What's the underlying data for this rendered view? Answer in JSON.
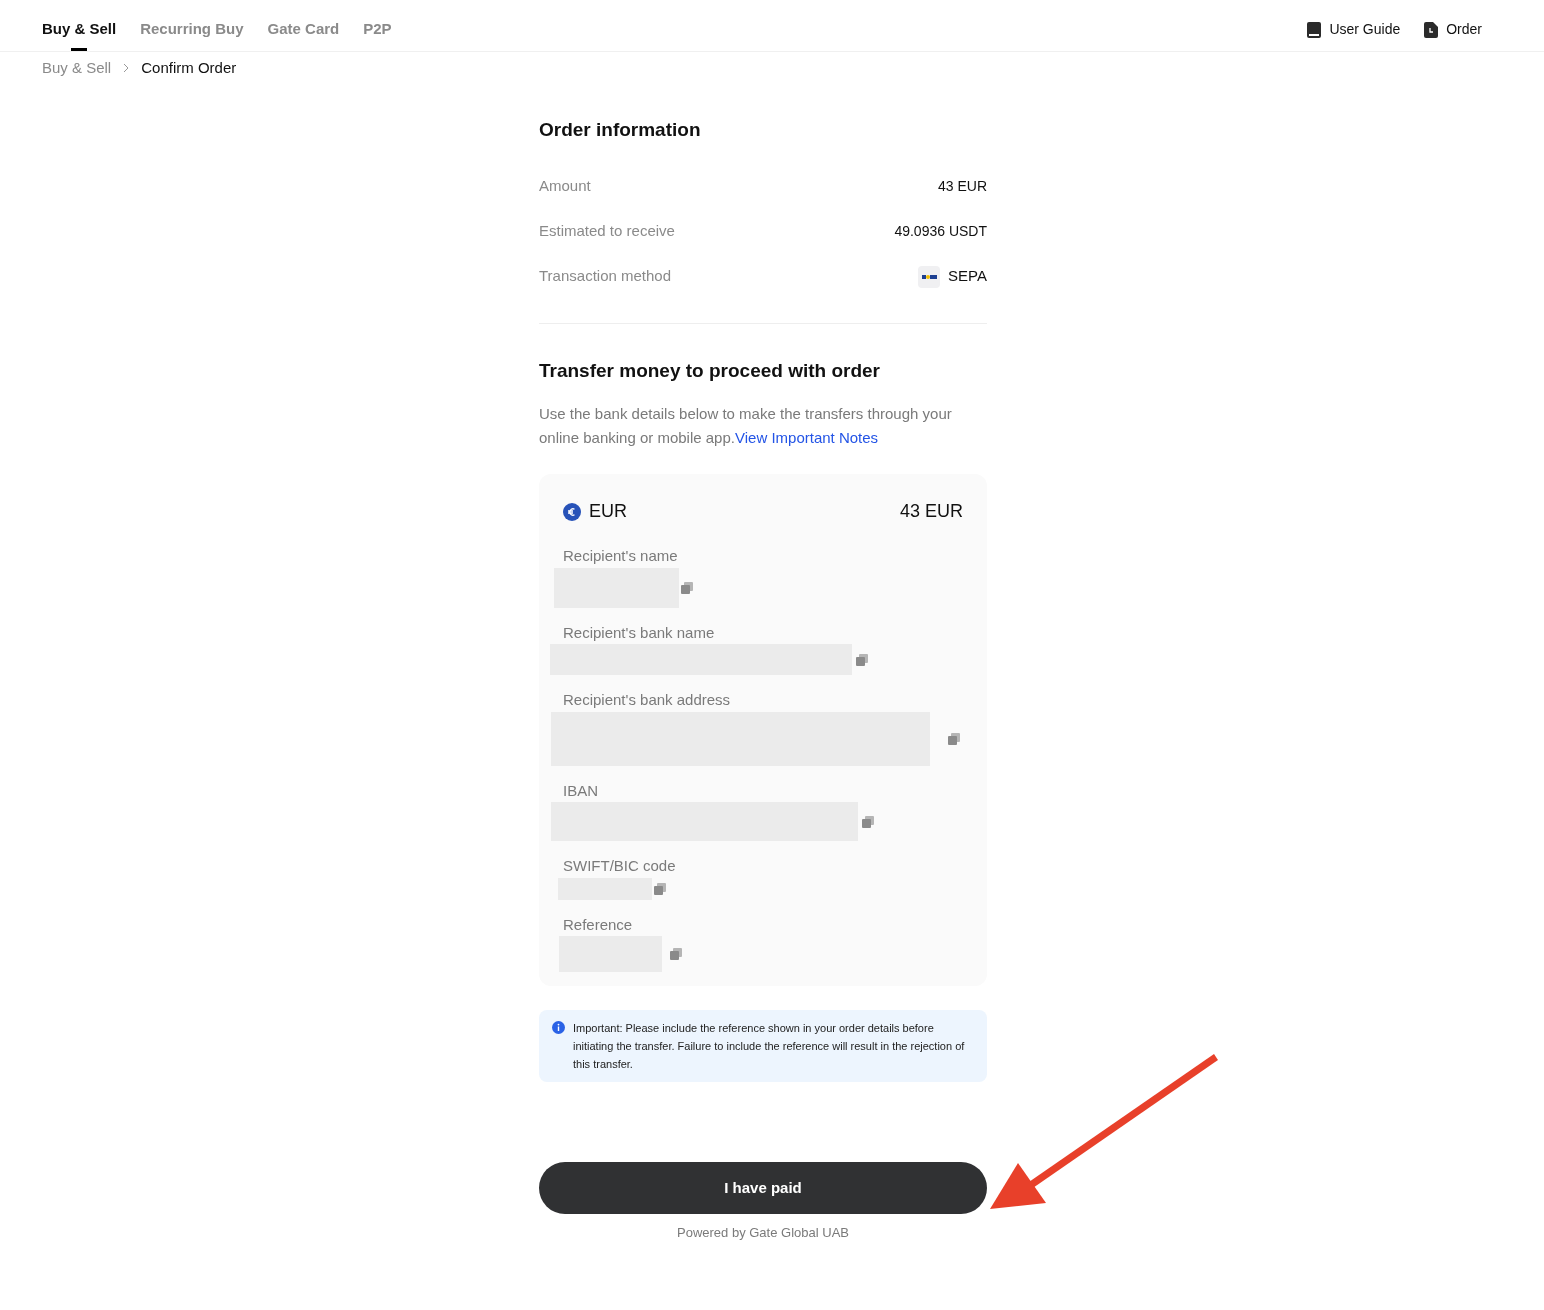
{
  "nav": {
    "tabs": [
      {
        "label": "Buy & Sell",
        "selected": true
      },
      {
        "label": "Recurring Buy",
        "selected": false
      },
      {
        "label": "Gate Card",
        "selected": false
      },
      {
        "label": "P2P",
        "selected": false
      }
    ],
    "links": [
      {
        "kind": "guide",
        "label": "User Guide"
      },
      {
        "kind": "order",
        "label": "Order"
      }
    ]
  },
  "breadcrumb": [
    "Buy & Sell",
    "Confirm Order"
  ],
  "order_info": {
    "title": "Order information",
    "rows": [
      {
        "label": "Amount",
        "value": "43 EUR"
      },
      {
        "label": "Estimated to receive",
        "value": "49.0936 USDT"
      },
      {
        "label": "Transaction method",
        "value": "SEPA",
        "logo": true
      }
    ]
  },
  "transfer": {
    "title": "Transfer money to proceed with order",
    "text": "Use the bank details below to make the transfers through your online banking or mobile app.",
    "link": "View Important Notes"
  },
  "bank_card": {
    "currency": "EUR",
    "amount": "43 EUR",
    "fields": [
      {
        "label": "Recipient's name"
      },
      {
        "label": "Recipient's bank name"
      },
      {
        "label": "Recipient's bank address"
      },
      {
        "label": "IBAN"
      },
      {
        "label": "SWIFT/BIC code"
      },
      {
        "label": "Reference"
      }
    ]
  },
  "notice": "Important: Please include the reference shown in your order details before initiating the transfer. Failure to include the reference will result in the rejection of this transfer.",
  "button": "I have paid",
  "footer": "Powered by Gate Global UAB"
}
